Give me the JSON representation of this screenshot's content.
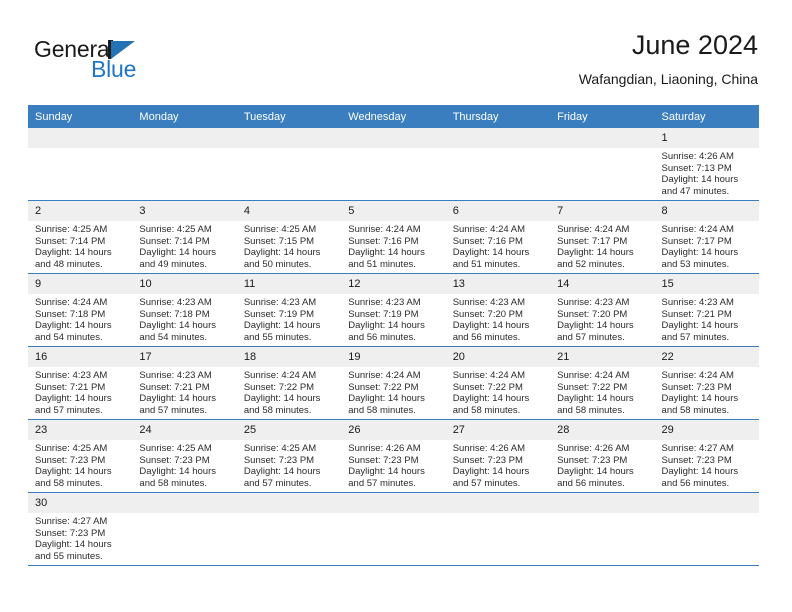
{
  "brand": {
    "name_part1": "General",
    "name_part2": "Blue",
    "accent_color": "#2272b5"
  },
  "header": {
    "month_title": "June 2024",
    "location": "Wafangdian, Liaoning, China"
  },
  "calendar": {
    "header_color": "#3a7ebf",
    "daynum_bg": "#efefef",
    "weekdays": [
      "Sunday",
      "Monday",
      "Tuesday",
      "Wednesday",
      "Thursday",
      "Friday",
      "Saturday"
    ],
    "weeks": [
      [
        {
          "day": "",
          "empty": true
        },
        {
          "day": "",
          "empty": true
        },
        {
          "day": "",
          "empty": true
        },
        {
          "day": "",
          "empty": true
        },
        {
          "day": "",
          "empty": true
        },
        {
          "day": "",
          "empty": true
        },
        {
          "day": "1",
          "sunrise": "Sunrise: 4:26 AM",
          "sunset": "Sunset: 7:13 PM",
          "daylight_1": "Daylight: 14 hours",
          "daylight_2": "and 47 minutes."
        }
      ],
      [
        {
          "day": "2",
          "sunrise": "Sunrise: 4:25 AM",
          "sunset": "Sunset: 7:14 PM",
          "daylight_1": "Daylight: 14 hours",
          "daylight_2": "and 48 minutes."
        },
        {
          "day": "3",
          "sunrise": "Sunrise: 4:25 AM",
          "sunset": "Sunset: 7:14 PM",
          "daylight_1": "Daylight: 14 hours",
          "daylight_2": "and 49 minutes."
        },
        {
          "day": "4",
          "sunrise": "Sunrise: 4:25 AM",
          "sunset": "Sunset: 7:15 PM",
          "daylight_1": "Daylight: 14 hours",
          "daylight_2": "and 50 minutes."
        },
        {
          "day": "5",
          "sunrise": "Sunrise: 4:24 AM",
          "sunset": "Sunset: 7:16 PM",
          "daylight_1": "Daylight: 14 hours",
          "daylight_2": "and 51 minutes."
        },
        {
          "day": "6",
          "sunrise": "Sunrise: 4:24 AM",
          "sunset": "Sunset: 7:16 PM",
          "daylight_1": "Daylight: 14 hours",
          "daylight_2": "and 51 minutes."
        },
        {
          "day": "7",
          "sunrise": "Sunrise: 4:24 AM",
          "sunset": "Sunset: 7:17 PM",
          "daylight_1": "Daylight: 14 hours",
          "daylight_2": "and 52 minutes."
        },
        {
          "day": "8",
          "sunrise": "Sunrise: 4:24 AM",
          "sunset": "Sunset: 7:17 PM",
          "daylight_1": "Daylight: 14 hours",
          "daylight_2": "and 53 minutes."
        }
      ],
      [
        {
          "day": "9",
          "sunrise": "Sunrise: 4:24 AM",
          "sunset": "Sunset: 7:18 PM",
          "daylight_1": "Daylight: 14 hours",
          "daylight_2": "and 54 minutes."
        },
        {
          "day": "10",
          "sunrise": "Sunrise: 4:23 AM",
          "sunset": "Sunset: 7:18 PM",
          "daylight_1": "Daylight: 14 hours",
          "daylight_2": "and 54 minutes."
        },
        {
          "day": "11",
          "sunrise": "Sunrise: 4:23 AM",
          "sunset": "Sunset: 7:19 PM",
          "daylight_1": "Daylight: 14 hours",
          "daylight_2": "and 55 minutes."
        },
        {
          "day": "12",
          "sunrise": "Sunrise: 4:23 AM",
          "sunset": "Sunset: 7:19 PM",
          "daylight_1": "Daylight: 14 hours",
          "daylight_2": "and 56 minutes."
        },
        {
          "day": "13",
          "sunrise": "Sunrise: 4:23 AM",
          "sunset": "Sunset: 7:20 PM",
          "daylight_1": "Daylight: 14 hours",
          "daylight_2": "and 56 minutes."
        },
        {
          "day": "14",
          "sunrise": "Sunrise: 4:23 AM",
          "sunset": "Sunset: 7:20 PM",
          "daylight_1": "Daylight: 14 hours",
          "daylight_2": "and 57 minutes."
        },
        {
          "day": "15",
          "sunrise": "Sunrise: 4:23 AM",
          "sunset": "Sunset: 7:21 PM",
          "daylight_1": "Daylight: 14 hours",
          "daylight_2": "and 57 minutes."
        }
      ],
      [
        {
          "day": "16",
          "sunrise": "Sunrise: 4:23 AM",
          "sunset": "Sunset: 7:21 PM",
          "daylight_1": "Daylight: 14 hours",
          "daylight_2": "and 57 minutes."
        },
        {
          "day": "17",
          "sunrise": "Sunrise: 4:23 AM",
          "sunset": "Sunset: 7:21 PM",
          "daylight_1": "Daylight: 14 hours",
          "daylight_2": "and 57 minutes."
        },
        {
          "day": "18",
          "sunrise": "Sunrise: 4:24 AM",
          "sunset": "Sunset: 7:22 PM",
          "daylight_1": "Daylight: 14 hours",
          "daylight_2": "and 58 minutes."
        },
        {
          "day": "19",
          "sunrise": "Sunrise: 4:24 AM",
          "sunset": "Sunset: 7:22 PM",
          "daylight_1": "Daylight: 14 hours",
          "daylight_2": "and 58 minutes."
        },
        {
          "day": "20",
          "sunrise": "Sunrise: 4:24 AM",
          "sunset": "Sunset: 7:22 PM",
          "daylight_1": "Daylight: 14 hours",
          "daylight_2": "and 58 minutes."
        },
        {
          "day": "21",
          "sunrise": "Sunrise: 4:24 AM",
          "sunset": "Sunset: 7:22 PM",
          "daylight_1": "Daylight: 14 hours",
          "daylight_2": "and 58 minutes."
        },
        {
          "day": "22",
          "sunrise": "Sunrise: 4:24 AM",
          "sunset": "Sunset: 7:23 PM",
          "daylight_1": "Daylight: 14 hours",
          "daylight_2": "and 58 minutes."
        }
      ],
      [
        {
          "day": "23",
          "sunrise": "Sunrise: 4:25 AM",
          "sunset": "Sunset: 7:23 PM",
          "daylight_1": "Daylight: 14 hours",
          "daylight_2": "and 58 minutes."
        },
        {
          "day": "24",
          "sunrise": "Sunrise: 4:25 AM",
          "sunset": "Sunset: 7:23 PM",
          "daylight_1": "Daylight: 14 hours",
          "daylight_2": "and 58 minutes."
        },
        {
          "day": "25",
          "sunrise": "Sunrise: 4:25 AM",
          "sunset": "Sunset: 7:23 PM",
          "daylight_1": "Daylight: 14 hours",
          "daylight_2": "and 57 minutes."
        },
        {
          "day": "26",
          "sunrise": "Sunrise: 4:26 AM",
          "sunset": "Sunset: 7:23 PM",
          "daylight_1": "Daylight: 14 hours",
          "daylight_2": "and 57 minutes."
        },
        {
          "day": "27",
          "sunrise": "Sunrise: 4:26 AM",
          "sunset": "Sunset: 7:23 PM",
          "daylight_1": "Daylight: 14 hours",
          "daylight_2": "and 57 minutes."
        },
        {
          "day": "28",
          "sunrise": "Sunrise: 4:26 AM",
          "sunset": "Sunset: 7:23 PM",
          "daylight_1": "Daylight: 14 hours",
          "daylight_2": "and 56 minutes."
        },
        {
          "day": "29",
          "sunrise": "Sunrise: 4:27 AM",
          "sunset": "Sunset: 7:23 PM",
          "daylight_1": "Daylight: 14 hours",
          "daylight_2": "and 56 minutes."
        }
      ],
      [
        {
          "day": "30",
          "sunrise": "Sunrise: 4:27 AM",
          "sunset": "Sunset: 7:23 PM",
          "daylight_1": "Daylight: 14 hours",
          "daylight_2": "and 55 minutes."
        },
        {
          "day": "",
          "empty": true
        },
        {
          "day": "",
          "empty": true
        },
        {
          "day": "",
          "empty": true
        },
        {
          "day": "",
          "empty": true
        },
        {
          "day": "",
          "empty": true
        },
        {
          "day": "",
          "empty": true
        }
      ]
    ]
  }
}
